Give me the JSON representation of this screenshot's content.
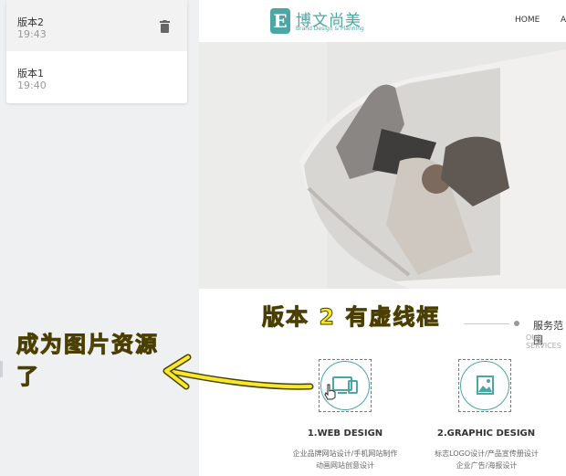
{
  "versions": [
    {
      "name": "版本2",
      "time": "19:43",
      "selected": true
    },
    {
      "name": "版本1",
      "time": "19:40",
      "selected": false
    }
  ],
  "icons": {
    "delete": "trash-icon"
  },
  "site": {
    "logo_letter": "E",
    "logo_name": "博文尚美",
    "logo_tagline": "Brand Design & Planning",
    "nav": {
      "home": "HOME",
      "next": "A"
    },
    "services_title": "服务范围",
    "services_sub": "OUR SERVICES",
    "services": [
      {
        "name": "1.WEB DESIGN",
        "desc1": "企业品牌网站设计/手机网站制作",
        "desc2": "动画网站创意设计"
      },
      {
        "name": "2.GRAPHIC DESIGN",
        "desc1": "标志LOGO设计/产品宣传册设计",
        "desc2": "企业广告/海报设计"
      }
    ]
  },
  "annotations": {
    "top": "版本 2 有虚线框",
    "left_line1": "成为图片资源",
    "left_line2": "了"
  },
  "colors": {
    "brand": "#4aa7a4",
    "annotation": "#f5e92a"
  }
}
